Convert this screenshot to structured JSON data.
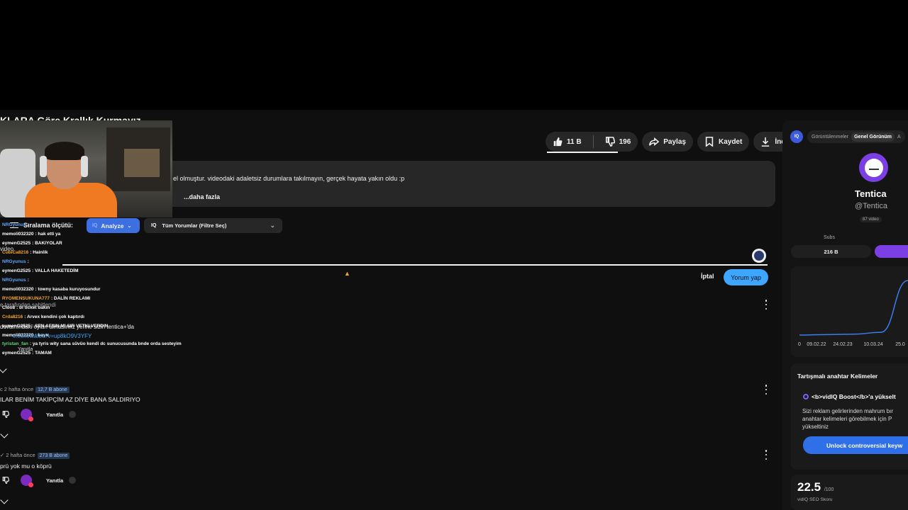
{
  "video": {
    "title": "KLARA Göre Krallık Kurmayız",
    "description_line": "el olmuştur. videodaki adaletsiz durumlara takılmayın, gerçek hayata yakın oldu :p",
    "description_more": "...daha fazla"
  },
  "actions": {
    "likes": "11 B",
    "dislikes": "196",
    "share": "Paylaş",
    "save": "Kaydet",
    "download": "İndir"
  },
  "comments_toolbar": {
    "sort_label": "Sıralama ölçütü:",
    "analyze": "Analyze",
    "filter": "Tüm Yorumlar (Filtre Seç)",
    "iq": "IQ"
  },
  "composer": {
    "cancel": "İptal",
    "submit": "Yorum yap"
  },
  "chat": [
    {
      "user": "NRGyunus",
      "msg": ":",
      "color": "#5ea7ff"
    },
    {
      "user": "memoli032320",
      "msg": ": hak etti ya",
      "color": "#ffffff"
    },
    {
      "user": "eymenG2525",
      "msg": ": BAKIYOLAR",
      "color": "#ffffff"
    },
    {
      "user": "CubiCa8216",
      "msg": ": Hainlik",
      "color": "#f5a623"
    },
    {
      "user": "NRGyunus",
      "msg": ":",
      "color": "#5ea7ff"
    },
    {
      "user": "eymenG2525",
      "msg": ": VALLA HAKETEDİM",
      "color": "#ffffff"
    },
    {
      "user": "NRGyunus",
      "msg": ":",
      "color": "#5ea7ff"
    },
    {
      "user": "memoli032320",
      "msg": ": towny kasaba kuruyosundur",
      "color": "#ffffff"
    },
    {
      "user": "RYOMENSUKUNA777",
      "msg": ": DALİN REKLAMI",
      "color": "#f5a623"
    },
    {
      "user": "Cloo8",
      "msg": ": bi ticket bakın",
      "color": "#ffffff"
    },
    {
      "user": "Crda8216",
      "msg": ": Arvex kendini çok kaptırdı",
      "color": "#f5a623"
    },
    {
      "user": "eymenG2525",
      "msg": ": SEN AFSIN MI SIR VETKI VERDIN",
      "color": "#ffffff"
    },
    {
      "user": "memoli032320",
      "msg": ": bayır",
      "color": "#ffffff"
    },
    {
      "user": "tyristan_fan",
      "msg": ": ya tyris wity sana süvüo kendi dc sunucusunda bnde orda sesteyim",
      "color": "#5ddc7a"
    },
    {
      "user": "eymenG2525",
      "msg": ": TAMAM",
      "color": "#ffffff"
    }
  ],
  "overlay": {
    "video_word": "video",
    "pinned_by": "e tarafından sabitlendi",
    "pinned_text": "devamındaki oyları almasımız yerine sizin tentica+'da",
    "pinned_link": "e.com/watch?v=up8kO9V3YFY",
    "reply": "Yanıtla"
  },
  "comments": [
    {
      "meta": "c 2 hafta önce",
      "subs": "12,7 B abone",
      "text": "ILAR BENİM TAKİPÇİM AZ DİYE BANA SALDIRIYO",
      "reply": "Yanıtla"
    },
    {
      "meta": "✓ 2 hafta önce",
      "subs": "273 B abone",
      "text": "prü yok mu o köprü",
      "reply": "Yanıtla"
    }
  ],
  "sidebar": {
    "logo": "IQ",
    "tab_views": "Görüntülenmeler",
    "tab_overview": "Genel Görünüm",
    "tab_more": "A",
    "channel_name": "Tentica",
    "channel_handle": "@Tentica",
    "video_count": "87 video",
    "subs_label": "Subs",
    "subs_value": "216 B",
    "keywords_title": "Tartışmalı anahtar Kelimeler",
    "boost_title": "<b>vidIQ Boost</b>'a yükselt",
    "boost_text": "Sizi reklam gelirlerinden mahrum bır anahtar kelimeleri görebilmek için P yükseltiniz",
    "unlock": "Unlock controversial keyw",
    "seo_value": "22.5",
    "seo_max": "/100",
    "seo_label": "vidIQ SEO Skoru"
  },
  "chart_data": {
    "type": "line",
    "categories": [
      "0",
      "09.02.22",
      "24.02.23",
      "10.03.24",
      "25.0"
    ],
    "x_tick_labels": [
      "0",
      "09.02.22",
      "24.02.23",
      "10.03.24",
      "25.0"
    ],
    "series": [
      {
        "values": [
          0,
          0.5,
          1,
          3,
          60
        ]
      }
    ],
    "color": "#3e7bf0"
  }
}
